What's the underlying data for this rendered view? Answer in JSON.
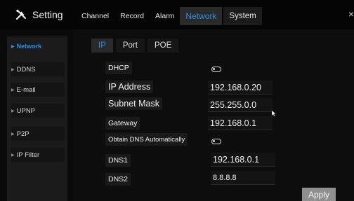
{
  "header": {
    "title": "Setting",
    "title_icon": "wrench-screwdriver-icon",
    "tabs": [
      {
        "label": "Channel"
      },
      {
        "label": "Record"
      },
      {
        "label": "Alarm"
      },
      {
        "label": "Network"
      },
      {
        "label": "System"
      }
    ],
    "active_tab": "Network",
    "close_label": "×"
  },
  "sidebar": {
    "items": [
      {
        "label": "Network",
        "active": true
      },
      {
        "label": "DDNS"
      },
      {
        "label": "E-mail"
      },
      {
        "label": "UPNP"
      },
      {
        "label": "P2P"
      },
      {
        "label": "IP Filter"
      }
    ],
    "arrow": "▶"
  },
  "subtabs": [
    {
      "label": "IP",
      "active": true
    },
    {
      "label": "Port"
    },
    {
      "label": "POE"
    }
  ],
  "form": {
    "dhcp_label": "DHCP",
    "dhcp_enabled": false,
    "ip_label": "IP Address",
    "ip_value": "192.168.0.20",
    "mask_label": "Subnet Mask",
    "mask_value": "255.255.0.0",
    "gateway_label": "Gateway",
    "gateway_value": "192.168.0.1",
    "auto_dns_label": "Obtain DNS Automatically",
    "auto_dns_enabled": false,
    "dns1_label": "DNS1",
    "dns1_value": "192.168.0.1",
    "dns2_label": "DNS2",
    "dns2_value": "8.8.8.8"
  },
  "apply_label": "Apply",
  "colors": {
    "accent": "#2b8fe8",
    "background": "#0d0d0d",
    "button": "#8f8f8f"
  }
}
